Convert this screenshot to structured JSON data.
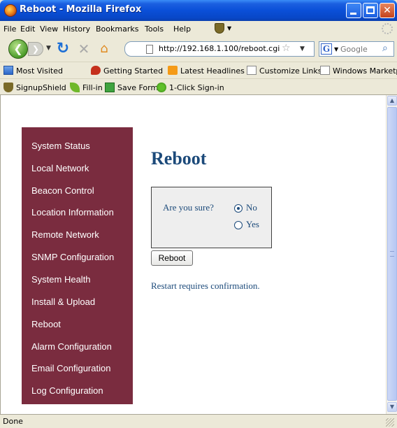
{
  "window": {
    "title": "Reboot - Mozilla Firefox"
  },
  "menu": [
    "File",
    "Edit",
    "View",
    "History",
    "Bookmarks",
    "Tools",
    "Help"
  ],
  "nav": {
    "url": "http://192.168.1.100/reboot.cgi",
    "search_placeholder": "Google"
  },
  "bookmarks": [
    "Most Visited",
    "Getting Started",
    "Latest Headlines",
    "Customize Links",
    "Windows Marketplace"
  ],
  "addons": [
    "SignupShield",
    "Fill-in",
    "Save Form",
    "1-Click Sign-in"
  ],
  "sidebar": {
    "items": [
      "System Status",
      "Local Network",
      "Beacon Control",
      "Location Information",
      "Remote Network",
      "SNMP Configuration",
      "System Health",
      "Install & Upload",
      "Reboot",
      "Alarm Configuration",
      "Email Configuration",
      "Log Configuration"
    ]
  },
  "main": {
    "title": "Reboot",
    "question": "Are you sure?",
    "options": [
      {
        "label": "No",
        "checked": true
      },
      {
        "label": "Yes",
        "checked": false
      }
    ],
    "button": "Reboot",
    "hint": "Restart requires confirmation."
  },
  "status": {
    "text": "Done"
  }
}
